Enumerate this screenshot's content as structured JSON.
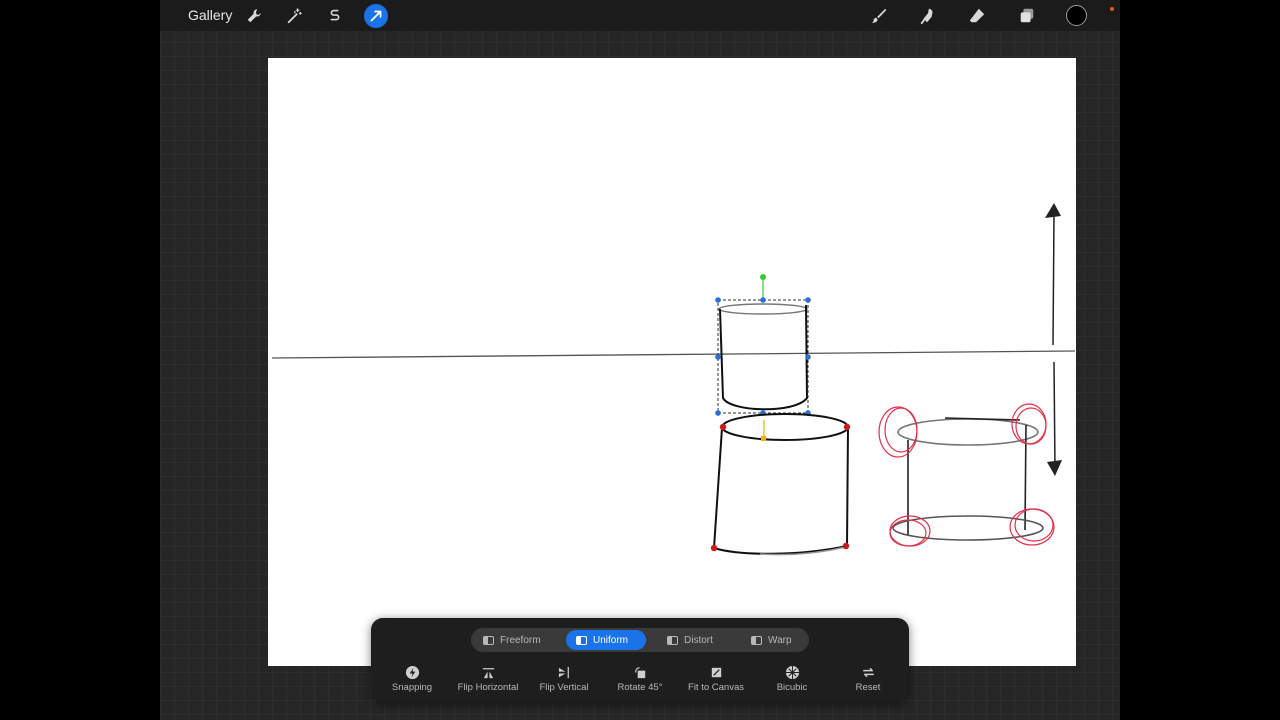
{
  "topbar": {
    "gallery_label": "Gallery",
    "tools_left": [
      {
        "name": "actions",
        "icon": "wrench-icon"
      },
      {
        "name": "adjustments",
        "icon": "magic-wand-icon"
      },
      {
        "name": "selection",
        "icon": "selection-s-icon"
      },
      {
        "name": "transform",
        "icon": "transform-arrow-icon",
        "active": true
      }
    ],
    "tools_right": [
      {
        "name": "brush",
        "icon": "brush-icon"
      },
      {
        "name": "smudge",
        "icon": "smudge-icon"
      },
      {
        "name": "eraser",
        "icon": "eraser-icon"
      },
      {
        "name": "layers",
        "icon": "layers-icon"
      },
      {
        "name": "color",
        "icon": "color-well",
        "value": "#000000"
      }
    ]
  },
  "transform_panel": {
    "modes": [
      {
        "label": "Freeform",
        "active": false
      },
      {
        "label": "Uniform",
        "active": true
      },
      {
        "label": "Distort",
        "active": false
      },
      {
        "label": "Warp",
        "active": false
      }
    ],
    "actions": [
      {
        "label": "Snapping",
        "icon": "snapping-bolt-icon"
      },
      {
        "label": "Flip Horizontal",
        "icon": "flip-horizontal-icon"
      },
      {
        "label": "Flip Vertical",
        "icon": "flip-vertical-icon"
      },
      {
        "label": "Rotate 45°",
        "icon": "rotate-icon"
      },
      {
        "label": "Fit to Canvas",
        "icon": "fit-canvas-icon"
      },
      {
        "label": "Bicubic",
        "icon": "bicubic-icon"
      },
      {
        "label": "Reset",
        "icon": "reset-icon"
      }
    ]
  },
  "colors": {
    "accent": "#1a73e8",
    "handle_blue": "#2a6fd6",
    "handle_green": "#33cc33",
    "handle_red": "#cc1a1a",
    "handle_yellow": "#f0b400",
    "sketch_red": "#e0304a"
  }
}
